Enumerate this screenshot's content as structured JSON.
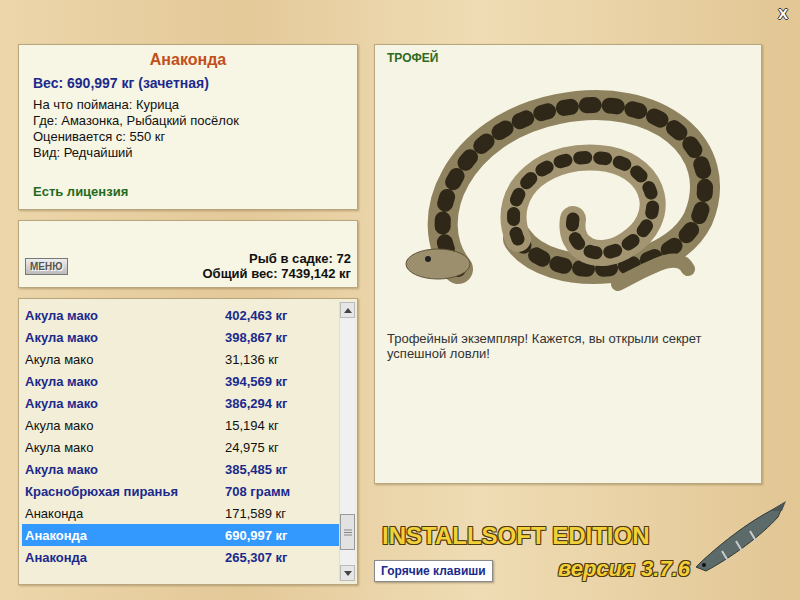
{
  "window": {
    "close": "X"
  },
  "catch": {
    "name": "Анаконда",
    "weight": "Вес: 690,997 кг (зачетная)",
    "details": [
      "На что поймана: Курица",
      "Где: Амазонка, Рыбацкий посёлок",
      "Оценивается с: 550 кг",
      "Вид: Редчайший"
    ],
    "license": "Есть лицензия"
  },
  "keepnet": {
    "menu": "МЕНЮ",
    "count": "Рыб в садке: 72",
    "total": "Общий вес: 7439,142 кг"
  },
  "list": {
    "scroll": {
      "level": 0.93
    },
    "rows": [
      {
        "name": "Акула мако",
        "weight": "402,463 кг",
        "trophy": true,
        "selected": false
      },
      {
        "name": "Акула мако",
        "weight": "398,867 кг",
        "trophy": true,
        "selected": false
      },
      {
        "name": "Акула мако",
        "weight": "31,136 кг",
        "trophy": false,
        "selected": false
      },
      {
        "name": "Акула мако",
        "weight": "394,569 кг",
        "trophy": true,
        "selected": false
      },
      {
        "name": "Акула мако",
        "weight": "386,294 кг",
        "trophy": true,
        "selected": false
      },
      {
        "name": "Акула мако",
        "weight": "15,194 кг",
        "trophy": false,
        "selected": false
      },
      {
        "name": "Акула мако",
        "weight": "24,975 кг",
        "trophy": false,
        "selected": false
      },
      {
        "name": "Акула мако",
        "weight": "385,485 кг",
        "trophy": true,
        "selected": false
      },
      {
        "name": "Краснобрюхая пиранья",
        "weight": "708 грамм",
        "trophy": true,
        "selected": false
      },
      {
        "name": "Анаконда",
        "weight": "171,589 кг",
        "trophy": false,
        "selected": false
      },
      {
        "name": "Анаконда",
        "weight": "690,997 кг",
        "trophy": true,
        "selected": true
      },
      {
        "name": "Анаконда",
        "weight": "265,307 кг",
        "trophy": true,
        "selected": false
      }
    ]
  },
  "trophy": {
    "label": "ТРОФЕЙ",
    "message": "Трофейный экземпляр! Кажется, вы открыли секрет успешной ловли!"
  },
  "hotkeys": "Горячие клавиши",
  "logo": {
    "title": "INSTALLSOFT EDITION",
    "version": "версия 3.7.6"
  }
}
